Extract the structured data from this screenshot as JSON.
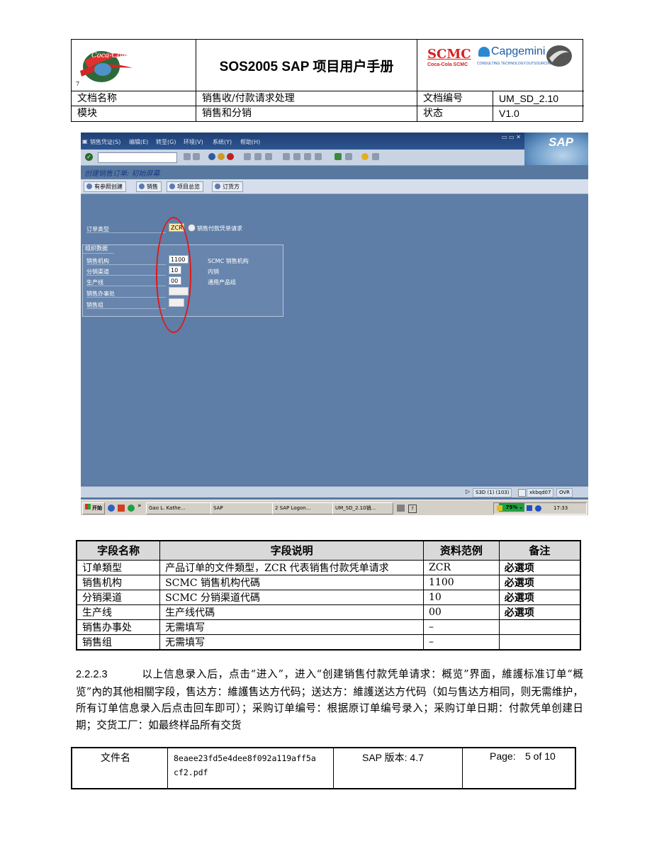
{
  "header": {
    "title": "SOS2005 SAP 项目用户手册",
    "doc_name_label": "文档名称",
    "doc_name_value": "销售收/付款请求处理",
    "doc_no_label": "文档编号",
    "doc_no_value": "UM_SD_2.10",
    "module_label": "模块",
    "module_value": "销售和分销",
    "status_label": "状态",
    "status_value": "V1.0",
    "logo_left_text": "Coca-Cola",
    "logo_left_number": "7",
    "scmc_text": "SCMC",
    "scmc_sub": "Coca-Cola SCMC",
    "capgemini_text": "Capgemini",
    "capgemini_sub": "CONSULTING.TECHNOLOGY.OUTSOURCING"
  },
  "sap": {
    "menu": [
      "销售凭证(S)",
      "编辑(E)",
      "转至(G)",
      "环境(V)",
      "系统(Y)",
      "帮助(H)"
    ],
    "brand": "SAP",
    "screen_title": "创建销售订单: 初始屏幕",
    "app_buttons": [
      "有参照创建",
      "销售",
      "项目总览",
      "订货方"
    ],
    "order_type_label": "订单类型",
    "order_type_value": "ZCR",
    "order_type_desc": "销售付款凭单请求",
    "org_group_title": "组织数据",
    "fields": [
      {
        "label": "销售机构",
        "value": "1100",
        "desc": "SCMC 销售机构"
      },
      {
        "label": "分销渠道",
        "value": "10",
        "desc": "内销"
      },
      {
        "label": "生产线",
        "value": "00",
        "desc": "通用产品组"
      },
      {
        "label": "销售办事处",
        "value": "",
        "desc": ""
      },
      {
        "label": "销售组",
        "value": "",
        "desc": ""
      }
    ],
    "status_system": "S3D (1) (103)",
    "status_user": "xkbqd07",
    "status_mode": "OVR",
    "taskbar": {
      "start": "开始",
      "items": [
        "Gao L. Kathe...",
        "SAP",
        "2 SAP Logon...",
        "UM_SD_2.10销..."
      ],
      "zoom": "75%",
      "time": "17:33"
    },
    "colors": {
      "highlight_oval": "#e01818",
      "menubar": "#1e3f74",
      "workarea": "#5e7ea8"
    }
  },
  "field_table": {
    "headers": [
      "字段名称",
      "字段说明",
      "资料范例",
      "备注"
    ],
    "rows": [
      [
        "订单類型",
        "产品订单的文件類型，ZCR 代表销售付款凭单请求",
        "ZCR",
        "必選项"
      ],
      [
        "销售机构",
        "SCMC 销售机构代碼",
        "1100",
        "必選项"
      ],
      [
        "分销渠道",
        "SCMC 分销渠道代碼",
        "10",
        "必選项"
      ],
      [
        "生产线",
        "生产线代碼",
        "00",
        "必選项"
      ],
      [
        "销售办事处",
        "无需填写",
        "–",
        ""
      ],
      [
        "销售组",
        "无需填写",
        "–",
        ""
      ]
    ]
  },
  "paragraph": {
    "number": "2.2.2.3",
    "text": "以上信息录入后，点击“进入”，进入“创建销售付款凭单请求：概览”界面，維護标准订单“概览”內的其他相關字段，售达方：維護售达方代码；送达方：維護送达方代码（如与售达方相同，则无需维护，所有订单信息录入后点击回车即可）；采购订单编号：根据原订单编号录入；采购订单日期：付款凭单创建日期；交货工厂：如最终样品所有交货"
  },
  "footer": {
    "file_label": "文件名",
    "file_name_line1": "8eaee23fd5e4dee8f092a119aff5a",
    "file_name_line2": "cf2.pdf",
    "sap_version": "SAP 版本: 4.7",
    "page_label": "Page:",
    "page_value": "5 of 10"
  }
}
